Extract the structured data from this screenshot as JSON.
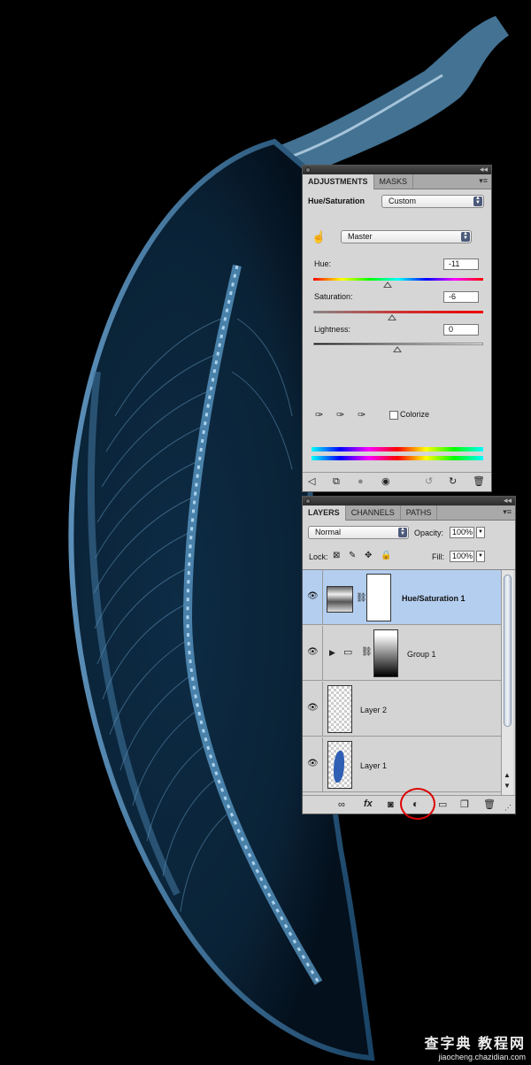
{
  "adjustments_panel": {
    "tabs": [
      "ADJUSTMENTS",
      "MASKS"
    ],
    "active_tab": "ADJUSTMENTS",
    "title": "Hue/Saturation",
    "preset": "Custom",
    "edit_channel": "Master",
    "hue": {
      "label": "Hue:",
      "value": "-11"
    },
    "saturation": {
      "label": "Saturation:",
      "value": "-6"
    },
    "lightness": {
      "label": "Lightness:",
      "value": "0"
    },
    "colorize_label": "Colorize",
    "colorize_checked": false
  },
  "layers_panel": {
    "tabs": [
      "LAYERS",
      "CHANNELS",
      "PATHS"
    ],
    "active_tab": "LAYERS",
    "blend_mode": "Normal",
    "opacity_label": "Opacity:",
    "opacity_value": "100%",
    "lock_label": "Lock:",
    "fill_label": "Fill:",
    "fill_value": "100%",
    "layers": [
      {
        "name": "Hue/Saturation 1",
        "selected": true
      },
      {
        "name": "Group 1",
        "selected": false
      },
      {
        "name": "Layer 2",
        "selected": false
      },
      {
        "name": "Layer 1",
        "selected": false
      }
    ],
    "footer_fx": "fx"
  },
  "watermark": {
    "line1": "查字典 教程网",
    "line2": "jiaocheng.chazidian.com"
  },
  "colors": {
    "selection": "#b4ceef",
    "highlight_circle": "#dd0000",
    "panel_bg": "#d6d6d6"
  }
}
